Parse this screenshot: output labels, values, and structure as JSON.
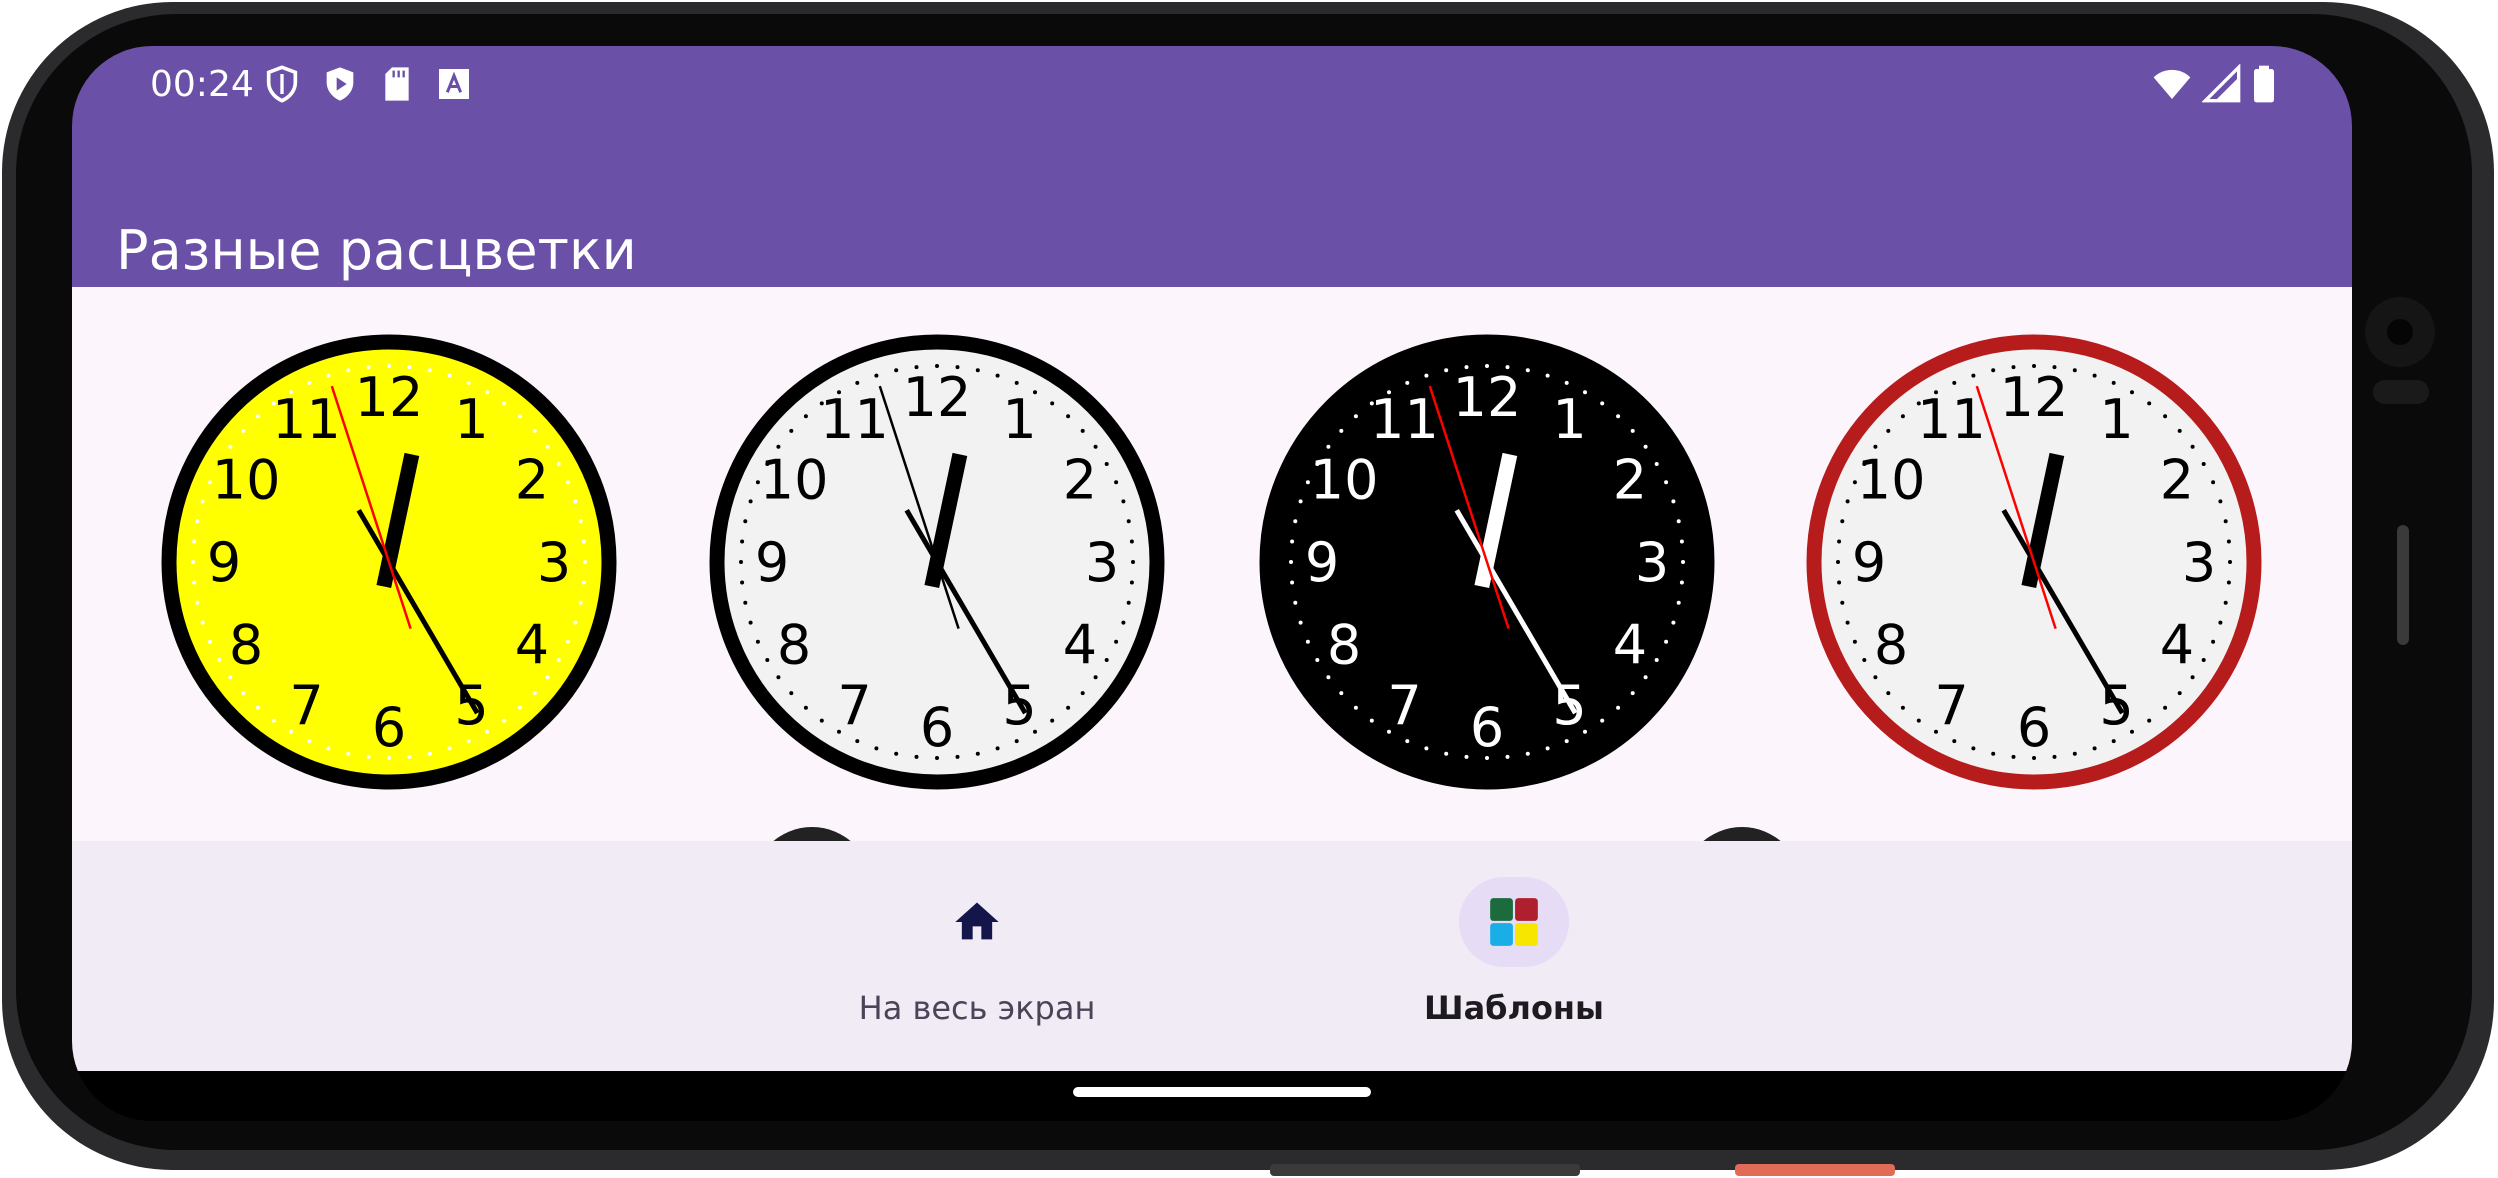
{
  "status_bar": {
    "time": "00:24",
    "left_icons": [
      "shield-outline-icon",
      "play-shield-icon",
      "sd-card-icon",
      "font-a-icon"
    ],
    "right_icons": [
      "wifi-icon",
      "signal-icon",
      "battery-icon"
    ]
  },
  "app_bar": {
    "title": "Разные расцветки"
  },
  "clocks": [
    {
      "name": "yellow",
      "face": "#ffff00",
      "rim": "#000000",
      "numerals": "#000000",
      "hands": "#000000",
      "second_hand": "#ff0000",
      "ticks": "#ffffff"
    },
    {
      "name": "white",
      "face": "#f2f2f2",
      "rim": "#000000",
      "numerals": "#000000",
      "hands": "#000000",
      "second_hand": "#000000",
      "ticks": "#000000"
    },
    {
      "name": "black",
      "face": "#000000",
      "rim": "#000000",
      "numerals": "#ffffff",
      "hands": "#ffffff",
      "second_hand": "#ff0000",
      "ticks": "#ffffff"
    },
    {
      "name": "red-rim",
      "face": "#f2f2f2",
      "rim": "#b71c1c",
      "numerals": "#000000",
      "hands": "#000000",
      "second_hand": "#ff0000",
      "ticks": "#000000"
    }
  ],
  "clock_time": {
    "hour": 0,
    "minute": 24,
    "second": 57
  },
  "numerals": [
    "12",
    "1",
    "2",
    "3",
    "4",
    "5",
    "6",
    "7",
    "8",
    "9",
    "10",
    "11"
  ],
  "bottom_nav": {
    "items": [
      {
        "label": "На весь экран",
        "icon": "home-icon",
        "active": false
      },
      {
        "label": "Шаблоны",
        "icon": "templates-grid-icon",
        "active": true
      }
    ]
  },
  "colors": {
    "accent": "#6a50a7",
    "background": "#fcf5fc",
    "nav_background": "#f1ebf6",
    "nav_active_pill": "#e6dcf5"
  }
}
